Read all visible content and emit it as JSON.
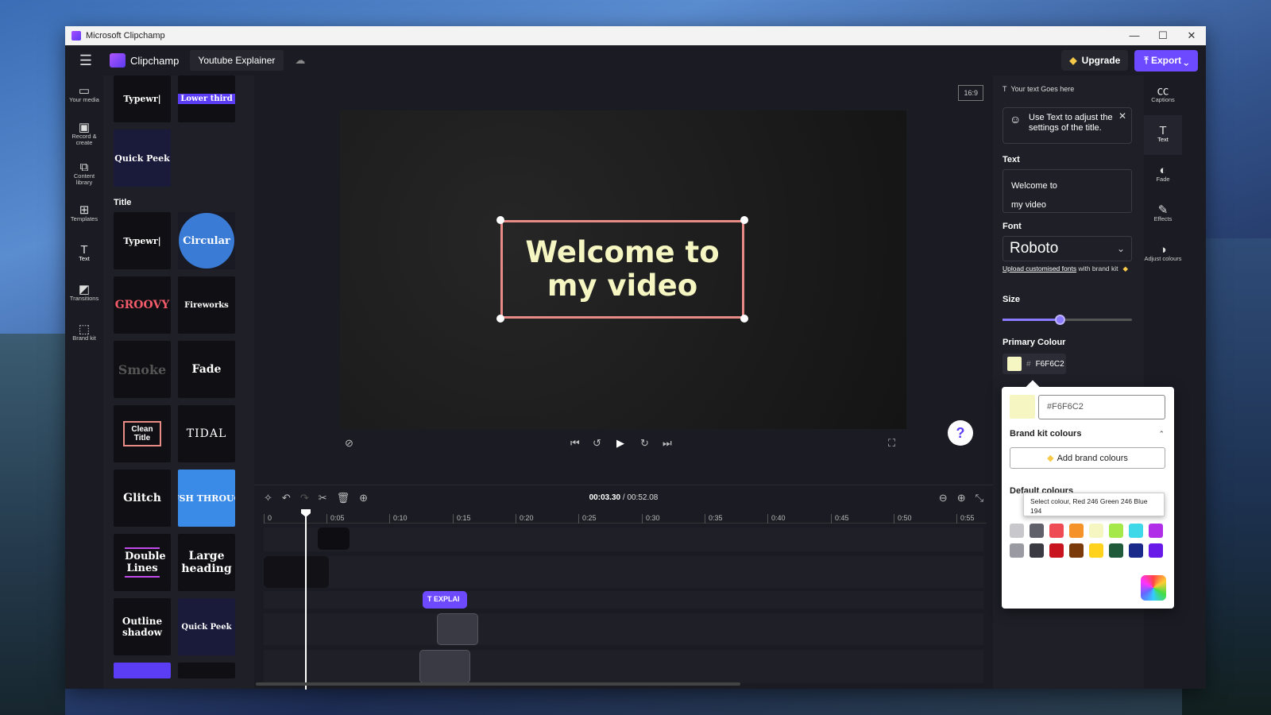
{
  "window": {
    "title": "Microsoft Clipchamp",
    "minimize": "—",
    "maximize": "☐",
    "close": "✕"
  },
  "topbar": {
    "menu_icon": "hamburger-icon",
    "brand": "Clipchamp",
    "project_name": "Youtube Explainer",
    "upgrade": "Upgrade",
    "export": "Export"
  },
  "leftnav": [
    {
      "label": "Your media",
      "icon": "folder-icon"
    },
    {
      "label": "Record & create",
      "icon": "camera-icon"
    },
    {
      "label": "Content library",
      "icon": "library-icon"
    },
    {
      "label": "Templates",
      "icon": "templates-icon"
    },
    {
      "label": "Text",
      "icon": "text-icon"
    },
    {
      "label": "Transitions",
      "icon": "transitions-icon"
    },
    {
      "label": "Brand kit",
      "icon": "brandkit-icon"
    }
  ],
  "panel": {
    "top_tiles": [
      "Typewr|",
      "Lower third",
      "Quick Peek"
    ],
    "section_title": "Title",
    "tiles": [
      "Typewr|",
      "Circular",
      "GROOVY",
      "Fireworks",
      "Smoke",
      "Fade",
      "Clean Title",
      "TIDAL",
      "Glitch",
      "USH THROUG",
      "Double Lines",
      "Large heading",
      "Outline shadow",
      "Quick Peek"
    ]
  },
  "stage": {
    "aspect_ratio": "16:9",
    "text_line1": "Welcome to",
    "text_line2": "my video",
    "help": "?"
  },
  "timeline": {
    "current": "00:03.30",
    "total": "00:52.08",
    "separator": " / ",
    "ticks": [
      "0",
      "0:05",
      "0:10",
      "0:15",
      "0:20",
      "0:25",
      "0:30",
      "0:35",
      "0:40",
      "0:45",
      "0:50",
      "0:55"
    ],
    "text_clip": "EXPLAI"
  },
  "props": {
    "header": "Your text Goes here",
    "tip": "Use Text to adjust the settings of the title.",
    "text_label": "Text",
    "text_value_line1": "Welcome to",
    "text_value_line2": "my video",
    "font_label": "Font",
    "font_value": "Roboto",
    "upload_link": "Upload customised fonts",
    "upload_suffix": " with brand kit",
    "size_label": "Size",
    "size_value": 0.44,
    "primary_colour_label": "Primary Colour",
    "primary_colour_hex": "F6F6C2"
  },
  "rightnav": [
    {
      "label": "Captions",
      "icon": "captions-icon"
    },
    {
      "label": "Text",
      "icon": "text-icon"
    },
    {
      "label": "Fade",
      "icon": "fade-icon"
    },
    {
      "label": "Effects",
      "icon": "effects-icon"
    },
    {
      "label": "Adjust colours",
      "icon": "adjust-colours-icon"
    }
  ],
  "colour_popup": {
    "hex_value": "#F6F6C2",
    "brand_kit_title": "Brand kit colours",
    "add_brand": "Add brand colours",
    "default_title": "Default colours",
    "tooltip": "Select colour, Red 246 Green 246 Blue 194",
    "row1": [
      "#c8c8cc",
      "#60606a",
      "#ef4b55",
      "#f5922a",
      "#f6f6c2",
      "#a4e84a",
      "#3fd8e8",
      "#b12ee8"
    ],
    "row2": [
      "#9a9aa2",
      "#3a3a42",
      "#c8141e",
      "#7a3a0a",
      "#ffd21e",
      "#1f5a3a",
      "#1a2a8a",
      "#6a1ae8"
    ]
  }
}
